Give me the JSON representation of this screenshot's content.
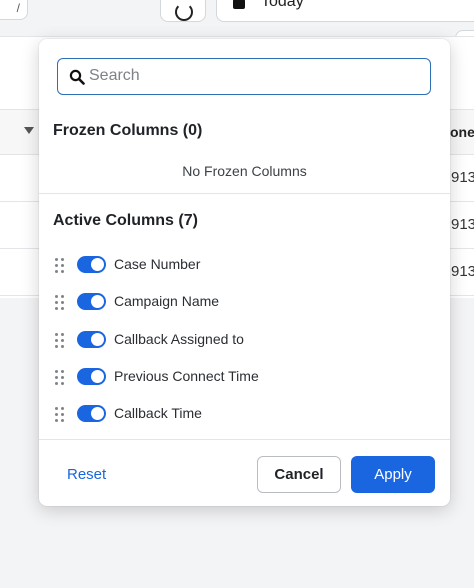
{
  "background": {
    "date_button_label": "Today",
    "left_button_glyph": "/",
    "table_header_fragment": "one",
    "row_fragments": [
      "913",
      "913",
      "913"
    ]
  },
  "panel": {
    "search": {
      "placeholder": "Search",
      "value": ""
    },
    "frozen": {
      "title": "Frozen Columns (0)",
      "empty_message": "No Frozen Columns"
    },
    "active": {
      "title": "Active Columns (7)",
      "items": [
        {
          "label": "Case Number",
          "enabled": true
        },
        {
          "label": "Campaign Name",
          "enabled": true
        },
        {
          "label": "Callback Assigned to",
          "enabled": true
        },
        {
          "label": "Previous Connect Time",
          "enabled": true
        },
        {
          "label": "Callback Time",
          "enabled": true
        }
      ]
    },
    "footer": {
      "reset_label": "Reset",
      "cancel_label": "Cancel",
      "apply_label": "Apply"
    }
  },
  "colors": {
    "accent": "#1a66e0",
    "search_border": "#2d6fb5",
    "text": "#1f2328"
  }
}
